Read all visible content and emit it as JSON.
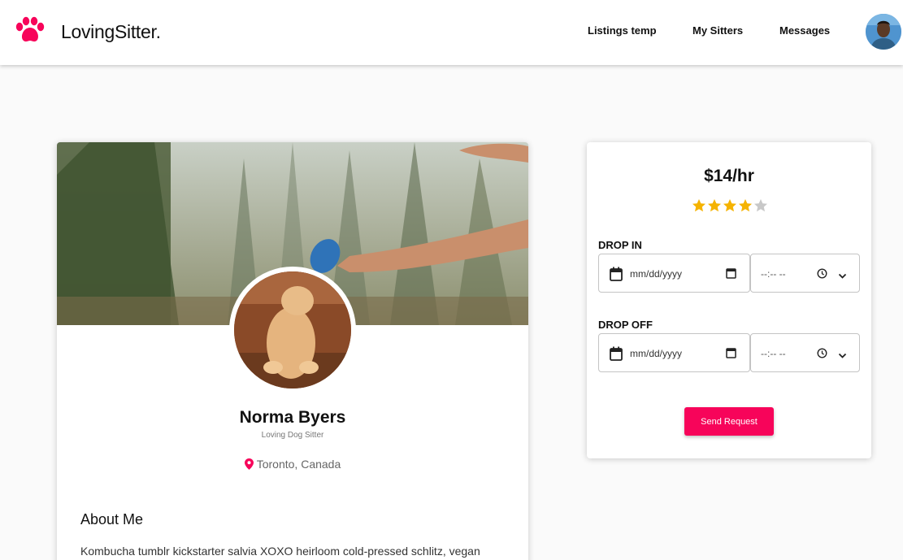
{
  "header": {
    "brand": "LovingSitter.",
    "nav": [
      "Listings temp",
      "My Sitters",
      "Messages"
    ]
  },
  "profile": {
    "name": "Norma Byers",
    "title": "Loving Dog Sitter",
    "location": "Toronto, Canada",
    "about_heading": "About Me",
    "about_text": "Kombucha tumblr kickstarter salvia XOXO heirloom cold-pressed schlitz, vegan"
  },
  "booking": {
    "price": "$14/hr",
    "rating": 4,
    "rating_max": 5,
    "drop_in_label": "DROP IN",
    "drop_off_label": "DROP OFF",
    "date_placeholder": "mm/dd/yyyy",
    "time_placeholder": "--:-- --",
    "send_label": "Send Request"
  },
  "colors": {
    "accent": "#f7045a",
    "star_filled": "#f5b301",
    "star_empty": "#c8c8c8"
  }
}
